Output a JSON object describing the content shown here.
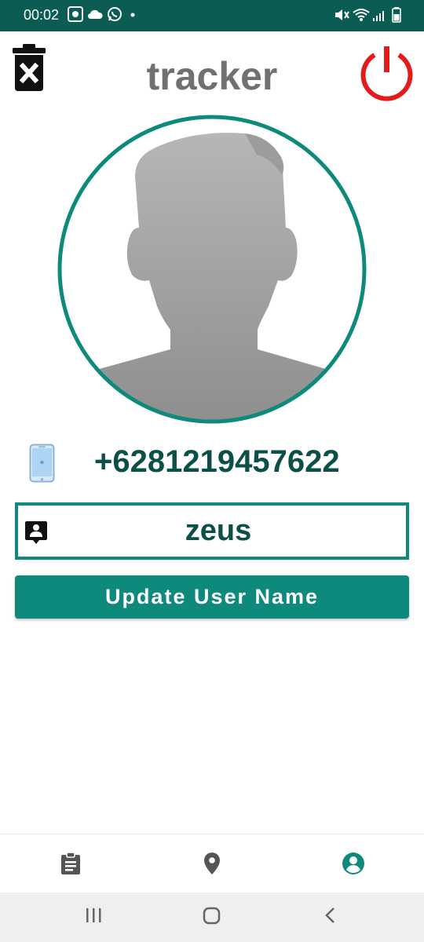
{
  "status_bar": {
    "time": "00:02",
    "left_icons": [
      "screen-record-icon",
      "cloud-icon",
      "whatsapp-icon",
      "dot-icon"
    ],
    "right_icons": [
      "mute-vibrate-icon",
      "wifi-icon",
      "signal-icon",
      "battery-icon"
    ]
  },
  "app_bar": {
    "title": "tracker",
    "left_action_icon": "delete-icon",
    "right_action_icon": "power-icon"
  },
  "profile": {
    "avatar_icon": "avatar-placeholder",
    "phone_icon": "phone-icon",
    "phone_number": "+6281219457622",
    "user_name_icon": "contact-icon",
    "user_name": "zeus",
    "update_button_label": "Update User Name"
  },
  "bottom_nav": {
    "items": [
      {
        "icon": "clipboard-icon",
        "active": false
      },
      {
        "icon": "location-pin-icon",
        "active": false
      },
      {
        "icon": "account-circle-icon",
        "active": true
      }
    ]
  },
  "system_nav": {
    "buttons": [
      "recent-apps-icon",
      "home-icon",
      "back-icon"
    ]
  },
  "colors": {
    "primary": "#0e8a7c",
    "dark_teal": "#0b5048",
    "status_bar": "#0b5d54",
    "power_red": "#e31b1b",
    "title_gray": "#707070"
  }
}
